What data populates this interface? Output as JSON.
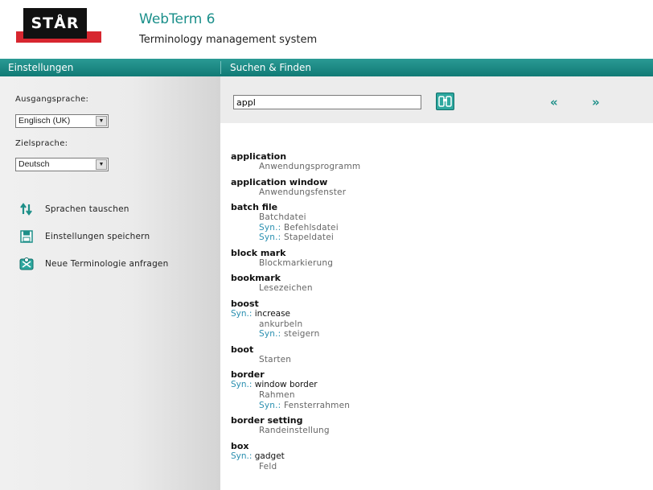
{
  "header": {
    "logo_text": "STÅR",
    "title": "WebTerm 6",
    "subtitle": "Terminology management system"
  },
  "bar": {
    "left_label": "Einstellungen",
    "right_label": "Suchen & Finden"
  },
  "sidebar": {
    "source_label": "Ausgangsprache:",
    "source_value": "Englisch (UK)",
    "target_label": "Zielsprache:",
    "target_value": "Deutsch",
    "actions": [
      {
        "label": "Sprachen tauschen",
        "icon": "swap-languages-icon"
      },
      {
        "label": "Einstellungen speichern",
        "icon": "save-icon"
      },
      {
        "label": "Neue Terminologie anfragen",
        "icon": "request-terminology-icon"
      }
    ]
  },
  "search": {
    "value": "appl",
    "prev_label": "«",
    "next_label": "»"
  },
  "colors": {
    "accent": "#1a8f8a",
    "bar": "#117a75",
    "synonym": "#2a8fb0",
    "logo_red": "#d7262f"
  },
  "syn_label": "Syn.:",
  "results": [
    {
      "term": "application",
      "src_syn": null,
      "translation": "Anwendungsprogramm",
      "trans_syns": []
    },
    {
      "term": "application window",
      "src_syn": null,
      "translation": "Anwendungsfenster",
      "trans_syns": []
    },
    {
      "term": "batch file",
      "src_syn": null,
      "translation": "Batchdatei",
      "trans_syns": [
        "Befehlsdatei",
        "Stapeldatei"
      ]
    },
    {
      "term": "block mark",
      "src_syn": null,
      "translation": "Blockmarkierung",
      "trans_syns": []
    },
    {
      "term": "bookmark",
      "src_syn": null,
      "translation": "Lesezeichen",
      "trans_syns": []
    },
    {
      "term": "boost",
      "src_syn": "increase",
      "translation": "ankurbeln",
      "trans_syns": [
        "steigern"
      ]
    },
    {
      "term": "boot",
      "src_syn": null,
      "translation": "Starten",
      "trans_syns": []
    },
    {
      "term": "border",
      "src_syn": "window border",
      "translation": "Rahmen",
      "trans_syns": [
        "Fensterrahmen"
      ]
    },
    {
      "term": "border setting",
      "src_syn": null,
      "translation": "Randeinstellung",
      "trans_syns": []
    },
    {
      "term": "box",
      "src_syn": "gadget",
      "translation": "Feld",
      "trans_syns": []
    }
  ]
}
